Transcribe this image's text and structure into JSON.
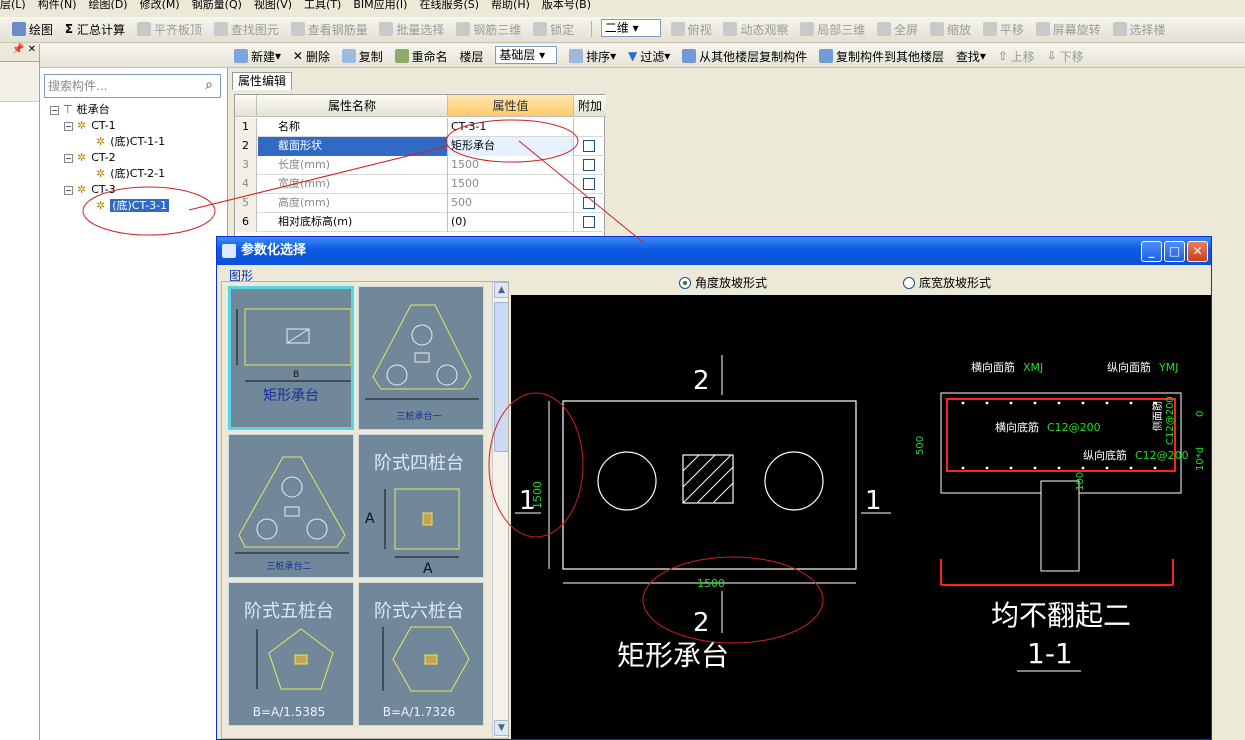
{
  "menu": [
    "层(L)",
    "构件(N)",
    "绘图(D)",
    "修改(M)",
    "钢筋量(Q)",
    "视图(V)",
    "工具(T)",
    "BIM应用(I)",
    "在线服务(S)",
    "帮助(H)",
    "版本号(B)"
  ],
  "toolbar1": {
    "draw": "绘图",
    "sum": "汇总计算",
    "flush": "平齐板顶",
    "find_elem": "查找图元",
    "view_rebar": "查看钢筋量",
    "batch_select": "批量选择",
    "rebar_3d": "钢筋三维",
    "lock": "锁定",
    "view2d": "二维",
    "top_view": "俯视",
    "dynamic": "动态观察",
    "local3d": "局部三维",
    "fullscreen": "全屏",
    "zoom": "缩放",
    "pan": "平移",
    "rotate": "屏幕旋转",
    "select_floor": "选择楼"
  },
  "toolbar2": {
    "new": "新建",
    "delete": "删除",
    "copy": "复制",
    "rename": "重命名",
    "floor_label": "楼层",
    "floor_value": "基础层",
    "sort": "排序",
    "filter": "过滤",
    "copy_from": "从其他楼层复制构件",
    "copy_to": "复制构件到其他楼层",
    "find": "查找",
    "up": "上移",
    "down": "下移"
  },
  "tree": {
    "search_placeholder": "搜索构件...",
    "root": "桩承台",
    "nodes": [
      {
        "label": "CT-1",
        "child": "(底)CT-1-1"
      },
      {
        "label": "CT-2",
        "child": "(底)CT-2-1"
      },
      {
        "label": "CT-3",
        "child": "(底)CT-3-1"
      }
    ]
  },
  "props": {
    "tab": "属性编辑",
    "headers": [
      "属性名称",
      "属性值",
      "附加"
    ],
    "rows": [
      {
        "n": "1",
        "name": "名称",
        "value": "CT-3-1"
      },
      {
        "n": "2",
        "name": "截面形状",
        "value": "矩形承台"
      },
      {
        "n": "3",
        "name": "长度(mm)",
        "value": "1500"
      },
      {
        "n": "4",
        "name": "宽度(mm)",
        "value": "1500"
      },
      {
        "n": "5",
        "name": "高度(mm)",
        "value": "500"
      },
      {
        "n": "6",
        "name": "相对底标高(m)",
        "value": "(0)"
      }
    ]
  },
  "dialog": {
    "title": "参数化选择",
    "group_label": "图形",
    "radio_angle": "角度放坡形式",
    "radio_width": "底宽放坡形式",
    "tiles": [
      {
        "big": "",
        "cap": "矩形承台",
        "label_b": "B"
      },
      {
        "big": "",
        "cap": "三桩承台一"
      },
      {
        "big": "",
        "cap": "三桩承台二"
      },
      {
        "big": "阶式四桩台",
        "label_a": "A"
      },
      {
        "big": "阶式五桩台",
        "bottom": "B=A/1.5385"
      },
      {
        "big": "阶式六桩台",
        "bottom": "B=A/1.7326"
      }
    ],
    "drawing": {
      "section_top": "2",
      "section_bottom": "2",
      "section_left": "1",
      "section_right": "1",
      "dim_vertical": "1500",
      "dim_horizontal": "1500",
      "plan_title": "矩形承台",
      "lbl_xmj_prefix": "横向面筋",
      "lbl_xmj": "XMJ",
      "lbl_ymj_prefix": "纵向面筋",
      "lbl_ymj": "YMJ",
      "lbl_xdj_prefix": "横向底筋",
      "lbl_xdj": "C12@200",
      "lbl_ydj_prefix": "纵向底筋",
      "lbl_ydj": "C12@200",
      "side_rebar": "侧面筋",
      "side_rebar_val": "C12@200",
      "height": "500",
      "cover_100": "100",
      "right_0": "0",
      "right_10d": "10*d",
      "section_title": "均不翻起二",
      "section_id": "1-1"
    }
  },
  "colors": {
    "selection": "#316ac5",
    "highlight_header": "#ffd88a",
    "dialog_title": "#0a52d6",
    "annotation": "#d02020",
    "rebar": "#ff2020",
    "dim_green": "#22dd22",
    "outline_yellow": "#e8e85a"
  }
}
